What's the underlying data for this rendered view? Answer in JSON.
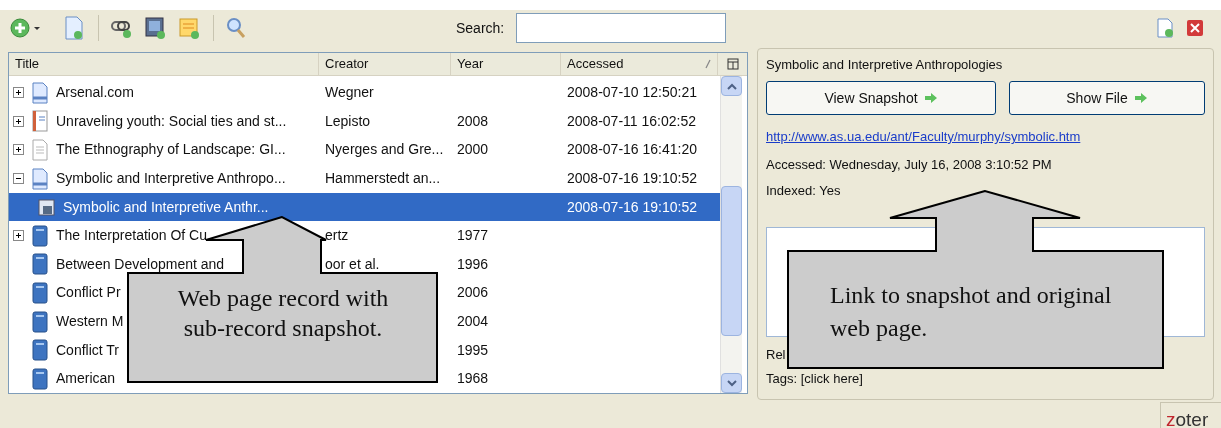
{
  "toolbar": {
    "search": {
      "label": "Search:"
    }
  },
  "items": {
    "columns": [
      {
        "label": "Title"
      },
      {
        "label": "Creator"
      },
      {
        "label": "Year"
      },
      {
        "label": "Accessed",
        "sorted": true
      }
    ],
    "rows": [
      {
        "kind": "webpage",
        "expanded": false,
        "title": "Arsenal.com",
        "creator": "Wegner",
        "accessed": "2008-07-10 12:50:21",
        "selected": false
      },
      {
        "kind": "report",
        "expanded": false,
        "title": "Unraveling youth: Social ties and st...",
        "creator": "Lepisto",
        "year": "2008",
        "accessed": "2008-07-11 16:02:52",
        "selected": false
      },
      {
        "kind": "document",
        "expanded": false,
        "title": "The Ethnography of Landscape: GI...",
        "creator": "Nyerges and Gre...",
        "year": "2000",
        "accessed": "2008-07-16 16:41:20",
        "selected": false
      },
      {
        "kind": "webpage",
        "expanded": true,
        "title": "Symbolic and Interpretive Anthropo...",
        "creator": "Hammerstedt an...",
        "accessed": "2008-07-16 19:10:52",
        "selected": false,
        "children": [
          {
            "kind": "snapshot",
            "title": "Symbolic and Interpretive Anthr...",
            "accessed": "2008-07-16 19:10:52",
            "selected": true
          }
        ]
      },
      {
        "kind": "book",
        "expanded": false,
        "title": "The Interpretation Of Cu",
        "creator": "ertz",
        "year": "1977",
        "selected": false
      },
      {
        "kind": "book",
        "title": "Between Development and",
        "creator": "oor et al.",
        "year": "1996",
        "selected": false
      },
      {
        "kind": "book",
        "title": "Conflict Pr",
        "year": "2006",
        "selected": false
      },
      {
        "kind": "book",
        "title": "Western M",
        "year": "2004",
        "selected": false
      },
      {
        "kind": "book",
        "title": "Conflict Tr",
        "year": "1995",
        "selected": false
      },
      {
        "kind": "book",
        "title": "American",
        "year": "1968",
        "selected": false
      }
    ]
  },
  "attachment": {
    "title": "Symbolic and Interpretive Anthropologies",
    "buttons": [
      "View Snapshot",
      "Show File"
    ],
    "url": "http://www.as.ua.edu/ant/Faculty/murphy/symbolic.htm",
    "accessed": "Accessed: Wednesday, July 16, 2008 3:10:52 PM",
    "indexed": "Indexed: Yes",
    "related": "Rel",
    "tags": "Tags: [click here]"
  },
  "status_bar": {
    "logo": "zoter"
  },
  "callouts": [
    "Web page record with sub-record snapshot.",
    "Link to snapshot and original web page."
  ]
}
